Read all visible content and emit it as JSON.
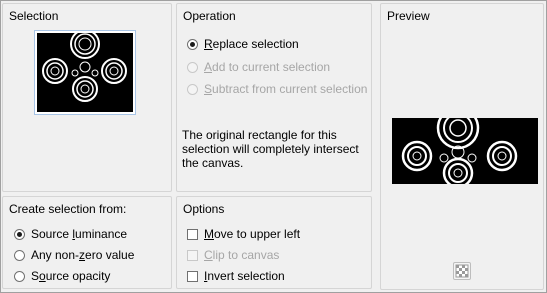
{
  "selection": {
    "title": "Selection"
  },
  "operation": {
    "title": "Operation",
    "options": [
      {
        "pre": "",
        "ul": "R",
        "post": "eplace selection",
        "selected": true,
        "enabled": true
      },
      {
        "pre": "",
        "ul": "A",
        "post": "dd to current selection",
        "selected": false,
        "enabled": false
      },
      {
        "pre": "",
        "ul": "S",
        "post": "ubtract from current selection",
        "selected": false,
        "enabled": false
      }
    ],
    "description": "The original rectangle for this selection will completely intersect the canvas."
  },
  "preview": {
    "title": "Preview"
  },
  "create": {
    "title": "Create selection from:",
    "options": [
      {
        "pre": "Source ",
        "ul": "l",
        "post": "uminance",
        "selected": true
      },
      {
        "pre": "Any non-",
        "ul": "z",
        "post": "ero value",
        "selected": false
      },
      {
        "pre": "S",
        "ul": "o",
        "post": "urce opacity",
        "selected": false
      }
    ]
  },
  "options": {
    "title": "Options",
    "items": [
      {
        "pre": "",
        "ul": "M",
        "post": "ove to upper left",
        "checked": false,
        "enabled": true
      },
      {
        "pre": "",
        "ul": "C",
        "post": "lip to canvas",
        "checked": false,
        "enabled": false
      },
      {
        "pre": "",
        "ul": "I",
        "post": "nvert selection",
        "checked": false,
        "enabled": true
      }
    ]
  }
}
